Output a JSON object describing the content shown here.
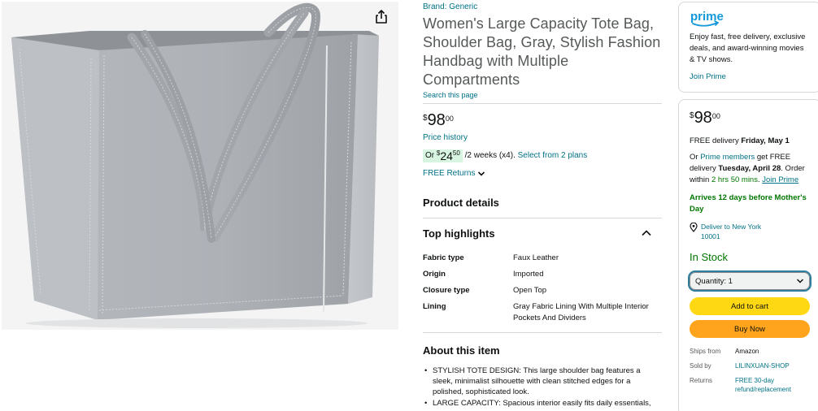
{
  "image": {
    "alt": "Gray leather tote bag"
  },
  "share": {
    "icon": "share-icon"
  },
  "product": {
    "brand": "Brand: Generic",
    "title": "Women's Large Capacity Tote Bag, Shoulder Bag, Gray, Stylish Fashion Handbag with Multiple Compartments",
    "search_page": "Search this page",
    "price": {
      "symbol": "$",
      "whole": "98",
      "fraction": "00"
    },
    "price_history": "Price history",
    "installment": {
      "prefix": "Or ",
      "symbol": "$",
      "whole": "24",
      "fraction": "50",
      "terms": " /2 weeks (x4). ",
      "plans_link": "Select from 2 plans"
    },
    "free_returns": "FREE Returns"
  },
  "product_details": {
    "heading": "Product details",
    "highlights_heading": "Top highlights",
    "specs": [
      {
        "key": "Fabric type",
        "value": "Faux Leather"
      },
      {
        "key": "Origin",
        "value": "Imported"
      },
      {
        "key": "Closure type",
        "value": "Open Top"
      },
      {
        "key": "Lining",
        "value": "Gray Fabric Lining With Multiple Interior Pockets And Dividers"
      }
    ]
  },
  "about": {
    "heading": "About this item",
    "bullets": [
      "STYLISH TOTE DESIGN: This large shoulder bag features a sleek, minimalist silhouette with clean stitched edges for a polished, sophisticated look.",
      "LARGE CAPACITY: Spacious interior easily fits daily essentials,"
    ]
  },
  "prime_card": {
    "logo": "prime",
    "description": "Enjoy fast, free delivery, exclusive deals, and award-winning movies & TV shows.",
    "join": "Join Prime"
  },
  "buy_box": {
    "price": {
      "symbol": "$",
      "whole": "98",
      "fraction": "00"
    },
    "delivery_prefix": "FREE delivery ",
    "delivery_date": "Friday, May 1",
    "members_prefix": "Or ",
    "members_link": "Prime members",
    "members_text1": " get FREE delivery ",
    "members_date": "Tuesday, April 28",
    "members_text2": ". Order within ",
    "members_countdown": "2 hrs 50 mins",
    "members_text3": ". ",
    "members_join": "Join Prime",
    "arrives": "Arrives 12 days before Mother's Day",
    "deliver_to": "Deliver to New York 10001",
    "stock": "In Stock",
    "quantity": "Quantity: 1",
    "add_to_cart": "Add to cart",
    "buy_now": "Buy Now",
    "ships_from_label": "Ships from",
    "ships_from_value": "Amazon",
    "sold_by_label": "Sold by",
    "sold_by_value": "LILINXUAN-SHOP",
    "returns_label": "Returns",
    "returns_value": "FREE 30-day refund/replacement"
  },
  "colors": {
    "link": "#007185",
    "prime_blue": "#1399d9",
    "in_stock_green": "#007600",
    "add_to_cart": "#ffd814",
    "buy_now": "#ffa41c",
    "installment_bg": "#d8f5e2"
  }
}
